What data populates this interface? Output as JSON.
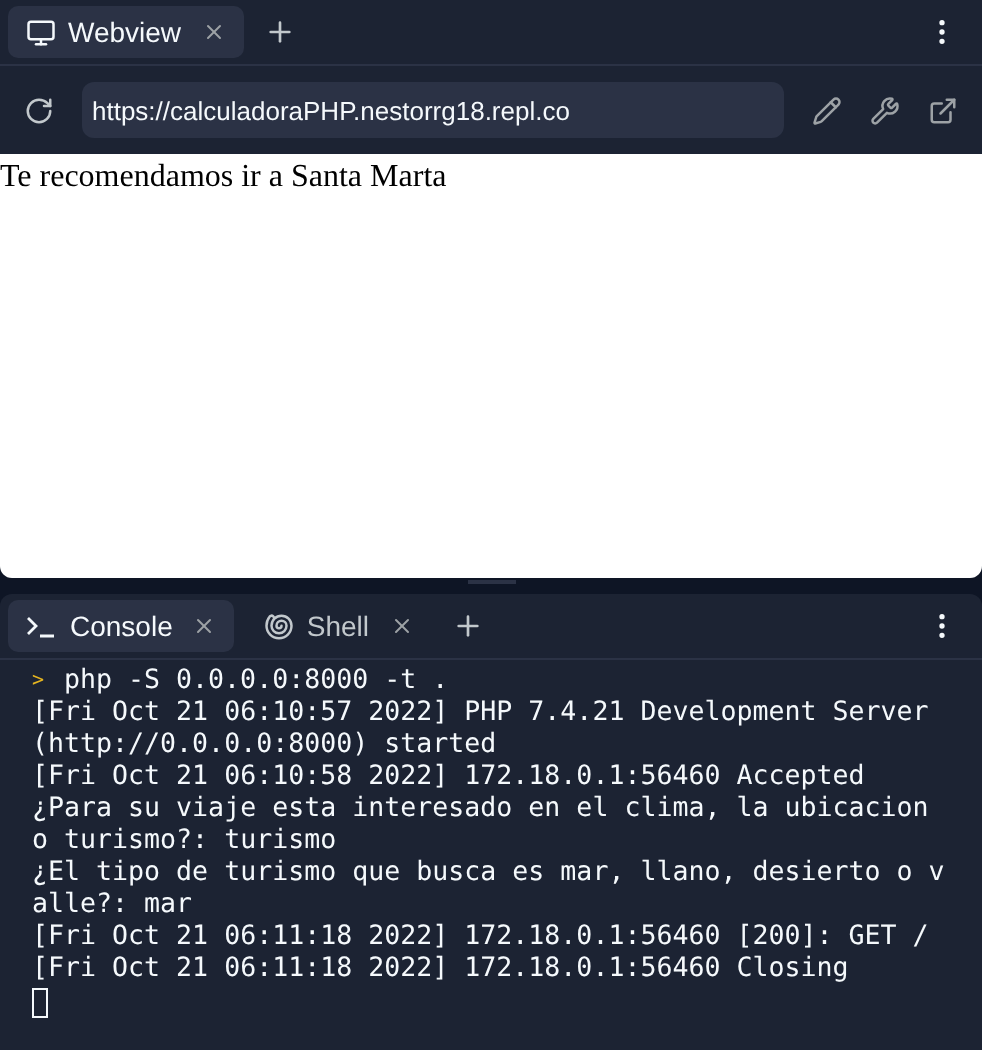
{
  "webview_pane": {
    "tabs": [
      {
        "label": "Webview",
        "kind": "webview",
        "selected": true
      }
    ],
    "url_bar": {
      "value": "https://calculadoraPHP.nestorrg18.repl.co"
    },
    "page_text": "Te recomendamos ir a Santa Marta"
  },
  "console_pane": {
    "tabs": [
      {
        "label": "Console",
        "kind": "console",
        "selected": true
      },
      {
        "label": "Shell",
        "kind": "shell",
        "selected": false
      }
    ],
    "command": {
      "prompt": ">",
      "text": "php -S 0.0.0.0:8000 -t ."
    },
    "output_lines": [
      "[Fri Oct 21 06:10:57 2022] PHP 7.4.21 Development Server",
      "(http://0.0.0.0:8000) started",
      "[Fri Oct 21 06:10:58 2022] 172.18.0.1:56460 Accepted",
      "¿Para su viaje esta interesado en el clima, la ubicacion",
      "o turismo?: turismo",
      "¿El tipo de turismo que busca es mar, llano, desierto o v",
      "alle?: mar",
      "[Fri Oct 21 06:11:18 2022] 172.18.0.1:56460 [200]: GET /",
      "[Fri Oct 21 06:11:18 2022] 172.18.0.1:56460 Closing"
    ]
  }
}
